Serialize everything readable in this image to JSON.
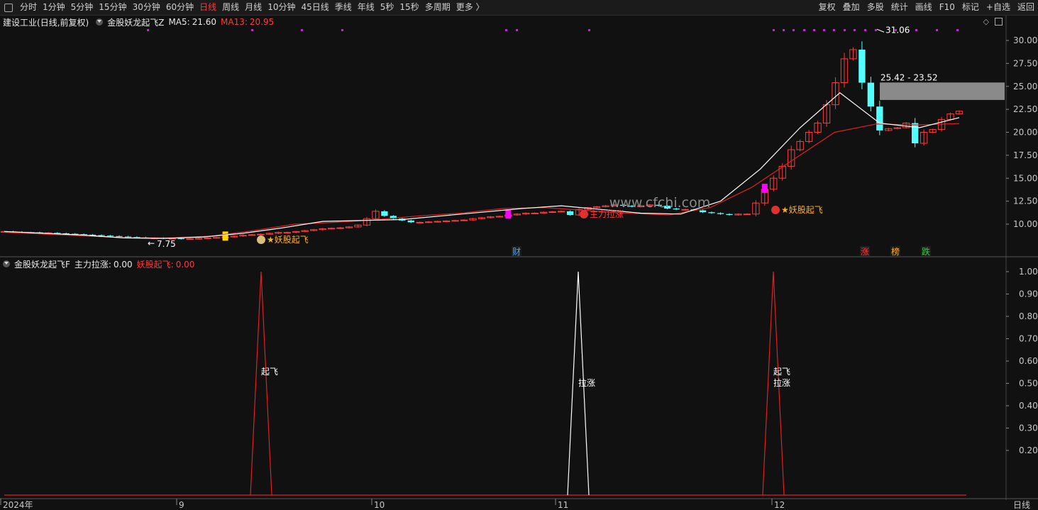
{
  "toolbar": {
    "items": [
      "分时",
      "1分钟",
      "5分钟",
      "15分钟",
      "30分钟",
      "60分钟",
      "日线",
      "周线",
      "月线",
      "10分钟",
      "45日线",
      "季线",
      "年线",
      "5秒",
      "15秒",
      "多周期",
      "更多 〉"
    ],
    "active_index": 6,
    "right": [
      "复权",
      "叠加",
      "多股",
      "统计",
      "画线",
      "F10",
      "标记",
      "+自选",
      "返回"
    ]
  },
  "main": {
    "stock_name": "建设工业",
    "mode": "(日线,前复权)",
    "indicator": "金股妖龙起飞Z",
    "ma5_label": "MA5:",
    "ma5_value": "21.60",
    "ma13_label": "MA13:",
    "ma13_value": "20.95",
    "low_label": "7.75",
    "high_label": "31.06",
    "range_label": "25.42 - 23.52",
    "signal_labels": [
      "★妖股起飞",
      "主力拉涨",
      "★妖股起飞"
    ],
    "badges": [
      "财",
      "涨",
      "榜",
      "跌"
    ],
    "badge_colors": [
      "#4aa3ff",
      "#ff3a3a",
      "#ffb020",
      "#2ecc40"
    ],
    "watermark": "www.cfchi.com"
  },
  "sub": {
    "indicator": "金股妖龙起飞F",
    "f1_label": "主力拉涨:",
    "f1_value": "0.00",
    "f2_label": "妖股起飞:",
    "f2_value": "0.00",
    "peak_labels": [
      [
        "起飞"
      ],
      [
        "拉涨"
      ],
      [
        "起飞",
        "拉涨"
      ]
    ]
  },
  "price_axis": [
    "30.00",
    "27.50",
    "25.00",
    "22.50",
    "20.00",
    "17.50",
    "15.00",
    "12.50",
    "10.00"
  ],
  "sub_axis": [
    "1.00",
    "0.90",
    "0.80",
    "0.70",
    "0.60",
    "0.50",
    "0.40",
    "0.30",
    "0.20"
  ],
  "dates": [
    "2024年",
    "9",
    "10",
    "11",
    "12"
  ],
  "period_label": "日线",
  "colors": {
    "up": "#ff3a3a",
    "down": "#54ffff",
    "ma5": "#ffffff",
    "ma13": "#e02020",
    "signal": "#ff00ff",
    "grid": "#333333",
    "bg": "#111111"
  },
  "chart_data": {
    "type": "candlestick",
    "price_range": [
      7.0,
      32.0
    ],
    "signal_range": [
      0,
      1.0
    ],
    "candle_closes": [
      9.2,
      9.15,
      9.1,
      9.1,
      9.05,
      9.05,
      9.0,
      8.95,
      8.9,
      8.85,
      8.8,
      8.75,
      8.7,
      8.65,
      8.6,
      8.55,
      8.5,
      8.5,
      8.45,
      8.45,
      8.4,
      8.4,
      8.45,
      8.5,
      8.55,
      8.6,
      8.7,
      8.8,
      8.85,
      8.9,
      9.0,
      9.1,
      9.1,
      9.2,
      9.3,
      9.4,
      9.5,
      9.55,
      9.6,
      9.7,
      9.9,
      10.6,
      11.4,
      10.9,
      10.6,
      10.4,
      10.2,
      10.2,
      10.25,
      10.3,
      10.35,
      10.4,
      10.45,
      10.6,
      10.7,
      10.8,
      10.85,
      11.0,
      11.1,
      11.2,
      11.2,
      11.3,
      11.35,
      11.4,
      11.0,
      11.6,
      11.8,
      11.9,
      12.0,
      12.1,
      12.0,
      11.9,
      12.0,
      12.1,
      12.0,
      11.7,
      11.6,
      11.6,
      11.5,
      11.3,
      11.2,
      11.1,
      11.0,
      11.1,
      11.1,
      12.3,
      13.8,
      15.0,
      16.3,
      18.1,
      19.0,
      20.0,
      21.0,
      23.0,
      25.4,
      28.0,
      29.0,
      25.4,
      22.8,
      20.2,
      20.4,
      20.5,
      21.0,
      18.8,
      20.0,
      20.3,
      21.4,
      22.0,
      22.3
    ],
    "ma5_approx": [
      9.2,
      9.0,
      8.8,
      8.5,
      8.45,
      8.6,
      9.0,
      9.6,
      10.3,
      10.4,
      10.5,
      10.9,
      11.3,
      11.7,
      12.0,
      11.6,
      11.2,
      11.1,
      12.5,
      16.0,
      20.5,
      24.3,
      21.0,
      20.5,
      21.6
    ],
    "ma13_approx": [
      9.1,
      8.9,
      8.7,
      8.5,
      8.5,
      8.7,
      9.3,
      10.0,
      10.2,
      10.5,
      10.9,
      11.2,
      11.7,
      11.8,
      11.5,
      11.2,
      11.0,
      11.8,
      14.0,
      17.0,
      20.0,
      20.9,
      20.8,
      20.95
    ],
    "signals": [
      {
        "index": 25,
        "value": 1.0,
        "label": "起飞"
      },
      {
        "index": 57,
        "value": 1.0,
        "label": "拉涨"
      },
      {
        "index": 86,
        "value": 1.0,
        "label": "起飞/拉涨"
      }
    ],
    "high": 31.06,
    "low": 7.75,
    "zone": [
      23.52,
      25.42
    ]
  }
}
